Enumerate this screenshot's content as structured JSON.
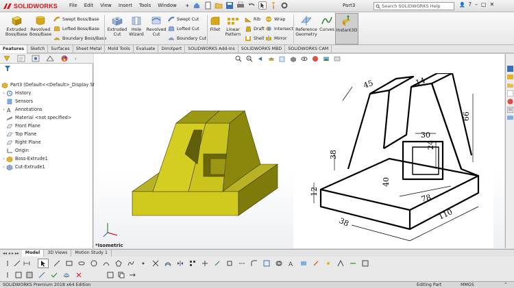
{
  "app": {
    "logo_text": "SOLIDWORKS",
    "logo_mark": "DS",
    "document_title": "Part3",
    "search_placeholder": "Search SOLIDWORKS Help"
  },
  "menu": [
    "File",
    "Edit",
    "View",
    "Insert",
    "Tools",
    "Window"
  ],
  "window_controls": {
    "minimize": "–",
    "restore": "▢",
    "close": "✕",
    "help": "?"
  },
  "ribbon": {
    "extruded_boss": "Extruded\nBoss/Base",
    "revolved_boss": "Revolved\nBoss/Base",
    "swept_boss": "Swept Boss/Base",
    "lofted_boss": "Lofted Boss/Base",
    "boundary_boss": "Boundary Boss/Base",
    "extruded_cut": "Extruded\nCut",
    "hole_wizard": "Hole\nWizard",
    "revolved_cut": "Revolved\nCut",
    "swept_cut": "Swept Cut",
    "lofted_cut": "Lofted Cut",
    "boundary_cut": "Boundary Cut",
    "fillet": "Fillet",
    "linear_pattern": "Linear\nPattern",
    "rib": "Rib",
    "draft": "Draft",
    "shell": "Shell",
    "wrap": "Wrap",
    "intersect": "Intersect",
    "mirror": "Mirror",
    "reference_geometry": "Reference\nGeometry",
    "curves": "Curves",
    "instant3d": "Instant3D"
  },
  "command_tabs": [
    "Features",
    "Sketch",
    "Surfaces",
    "Sheet Metal",
    "Mold Tools",
    "Evaluate",
    "DimXpert",
    "SOLIDWORKS Add-Ins",
    "SOLIDWORKS MBD",
    "SOLIDWORKS CAM"
  ],
  "active_command_tab": "Features",
  "tree": {
    "root": "Part3  (Default<<Default>_Display State",
    "items": [
      {
        "label": "History",
        "expandable": true,
        "icon": "history-icon"
      },
      {
        "label": "Sensors",
        "expandable": false,
        "icon": "sensors-icon"
      },
      {
        "label": "Annotations",
        "expandable": true,
        "icon": "annotations-icon"
      },
      {
        "label": "Material <not specified>",
        "expandable": false,
        "icon": "material-icon"
      },
      {
        "label": "Front Plane",
        "expandable": false,
        "icon": "plane-icon"
      },
      {
        "label": "Top Plane",
        "expandable": false,
        "icon": "plane-icon"
      },
      {
        "label": "Right Plane",
        "expandable": false,
        "icon": "plane-icon"
      },
      {
        "label": "Origin",
        "expandable": false,
        "icon": "origin-icon"
      },
      {
        "label": "Boss-Extrude1",
        "expandable": true,
        "icon": "boss-extrude-icon"
      },
      {
        "label": "Cut-Extrude1",
        "expandable": true,
        "icon": "cut-extrude-icon"
      }
    ]
  },
  "viewport": {
    "view_label": "*Isometric",
    "drawing_dims": [
      "45",
      "14",
      "66",
      "30",
      "24",
      "38",
      "40",
      "78",
      "110",
      "38",
      "12"
    ]
  },
  "bottom_tabs": [
    "Model",
    "3D Views",
    "Motion Study 1"
  ],
  "active_bottom_tab": "Model",
  "status": {
    "edition": "SOLIDWORKS Premium 2018 x64 Edition",
    "mode": "Editing Part",
    "units": "MMGS"
  },
  "colors": {
    "model_yellow": "#c9c31a",
    "model_shadow": "#7b7a0c",
    "brand_red": "#d4161b",
    "ribbon_icon_blue": "#3a6fb5"
  }
}
